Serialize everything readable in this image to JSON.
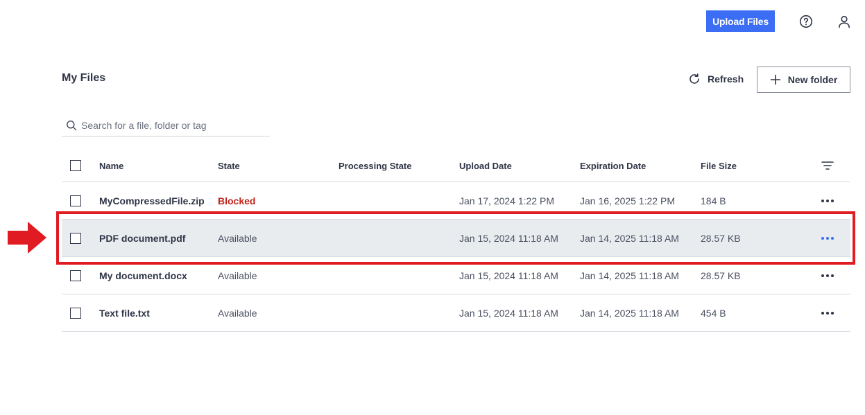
{
  "topbar": {
    "upload_label": "Upload Files",
    "help_icon": "help-circle-icon",
    "user_icon": "user-icon"
  },
  "heading": {
    "title": "My Files",
    "refresh_label": "Refresh",
    "new_folder_label": "New folder"
  },
  "search": {
    "placeholder": "Search for a file, folder or tag",
    "value": ""
  },
  "table": {
    "columns": [
      "Name",
      "State",
      "Processing State",
      "Upload Date",
      "Expiration Date",
      "File Size"
    ],
    "rows": [
      {
        "name": "MyCompressedFile.zip",
        "state": "Blocked",
        "processing_state": "",
        "upload_date": "Jan 17, 2024 1:22 PM",
        "expiration_date": "Jan 16, 2025 1:22 PM",
        "file_size": "184 B"
      },
      {
        "name": "PDF document.pdf",
        "state": "Available",
        "processing_state": "",
        "upload_date": "Jan 15, 2024 11:18 AM",
        "expiration_date": "Jan 14, 2025 11:18 AM",
        "file_size": "28.57 KB"
      },
      {
        "name": "My document.docx",
        "state": "Available",
        "processing_state": "",
        "upload_date": "Jan 15, 2024 11:18 AM",
        "expiration_date": "Jan 14, 2025 11:18 AM",
        "file_size": "28.57 KB"
      },
      {
        "name": "Text file.txt",
        "state": "Available",
        "processing_state": "",
        "upload_date": "Jan 15, 2024 11:18 AM",
        "expiration_date": "Jan 14, 2025 11:18 AM",
        "file_size": "454 B"
      }
    ]
  },
  "colors": {
    "accent": "#3b6ef5",
    "blocked": "#c0231c",
    "annotation": "#e11b22",
    "highlight_row": "#e9ecef"
  }
}
